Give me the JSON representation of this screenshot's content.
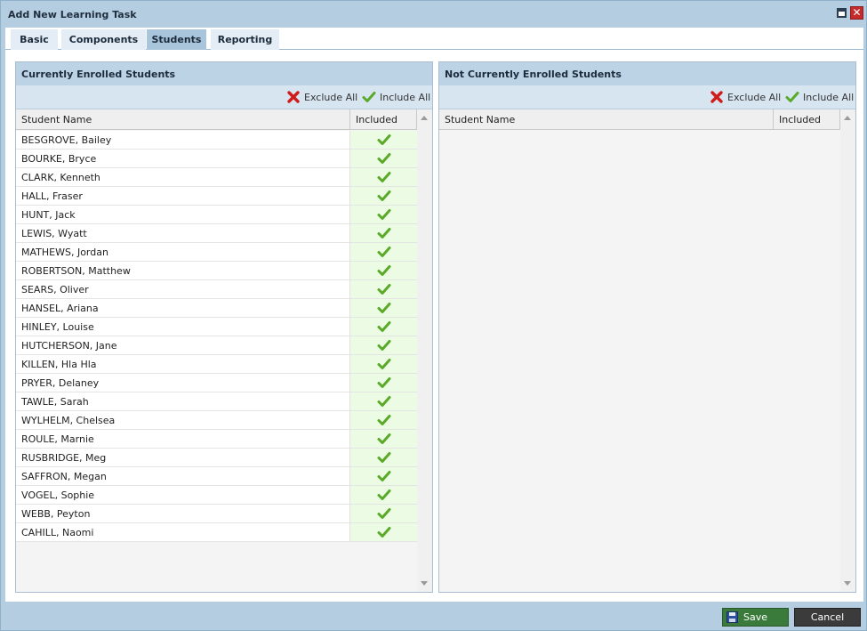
{
  "window": {
    "title": "Add New Learning Task",
    "close_glyph": "✕"
  },
  "tabs": [
    {
      "label": "Basic",
      "active": false
    },
    {
      "label": "Components",
      "active": false
    },
    {
      "label": "Students",
      "active": true
    },
    {
      "label": "Reporting",
      "active": false
    }
  ],
  "enrolled": {
    "header": "Currently Enrolled Students",
    "exclude_all_label": "Exclude All",
    "include_all_label": "Include All",
    "col_name": "Student Name",
    "col_included": "Included",
    "students": [
      "BESGROVE, Bailey",
      "BOURKE, Bryce",
      "CLARK, Kenneth",
      "HALL, Fraser",
      "HUNT, Jack",
      "LEWIS, Wyatt",
      "MATHEWS, Jordan",
      "ROBERTSON, Matthew",
      "SEARS, Oliver",
      "HANSEL, Ariana",
      "HINLEY, Louise",
      "HUTCHERSON, Jane",
      "KILLEN, Hla Hla",
      "PRYER, Delaney",
      "TAWLE, Sarah",
      "WYLHELM, Chelsea",
      "ROULE, Marnie",
      "RUSBRIDGE, Meg",
      "SAFFRON, Megan",
      "VOGEL, Sophie",
      "WEBB, Peyton",
      "CAHILL, Naomi"
    ]
  },
  "not_enrolled": {
    "header": "Not Currently Enrolled Students",
    "exclude_all_label": "Exclude All",
    "include_all_label": "Include All",
    "col_name": "Student Name",
    "col_included": "Included",
    "students": []
  },
  "footer": {
    "save_label": "Save",
    "cancel_label": "Cancel"
  },
  "colors": {
    "check": "#5aaa2a",
    "exclude": "#d11a1a",
    "save_bg": "#3a7b3c",
    "cancel_bg": "#3b3b3b",
    "header_bg": "#bcd3e6"
  }
}
